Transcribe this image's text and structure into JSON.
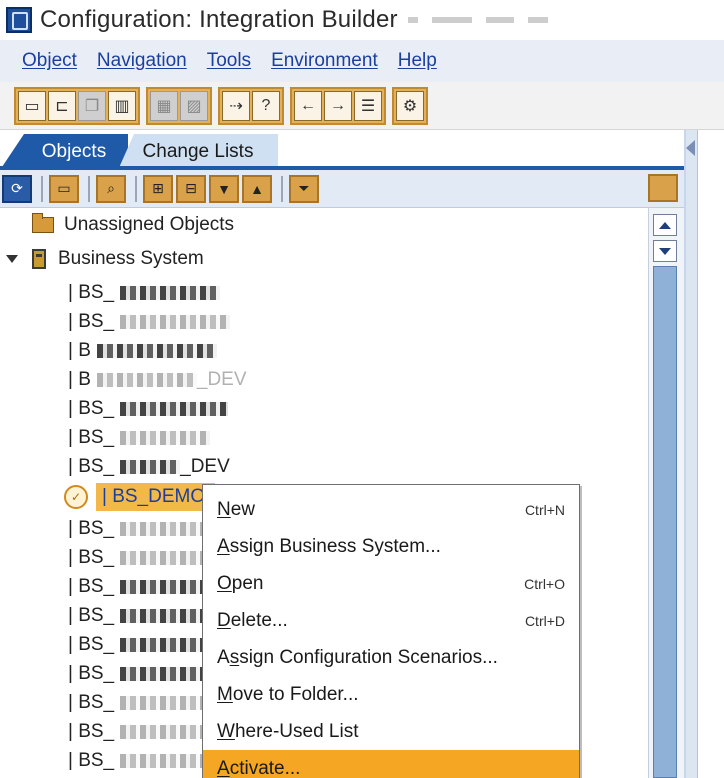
{
  "window": {
    "title": "Configuration: Integration Builder",
    "icon": "integration-builder-icon"
  },
  "menubar": {
    "items": [
      {
        "label": "Object",
        "mnemonic": "O"
      },
      {
        "label": "Navigation",
        "mnemonic": "N"
      },
      {
        "label": "Tools",
        "mnemonic": "T"
      },
      {
        "label": "Environment",
        "mnemonic": "E"
      },
      {
        "label": "Help",
        "mnemonic": "H"
      }
    ]
  },
  "toolbar": {
    "buttons": [
      {
        "name": "new-document-icon",
        "enabled": true
      },
      {
        "name": "open-folder-icon",
        "enabled": true
      },
      {
        "name": "copy-icon",
        "enabled": false
      },
      {
        "name": "delete-trash-icon",
        "enabled": true
      },
      {
        "name": "print-icon",
        "enabled": false
      },
      {
        "name": "print-preview-icon",
        "enabled": false
      },
      {
        "name": "navigate-icon",
        "enabled": true
      },
      {
        "name": "where-used-icon",
        "enabled": true
      },
      {
        "name": "back-arrow-icon",
        "enabled": true
      },
      {
        "name": "forward-arrow-icon",
        "enabled": true
      },
      {
        "name": "list-view-icon",
        "enabled": true
      },
      {
        "name": "settings-icon",
        "enabled": true
      }
    ]
  },
  "tabs": [
    {
      "label": "Objects",
      "active": true
    },
    {
      "label": "Change Lists",
      "active": false
    }
  ],
  "panel_toolbar": {
    "buttons": [
      "refresh-icon",
      "folder-view-icon",
      "find-icon",
      "expand-tree-icon",
      "collapse-tree-icon",
      "move-down-icon",
      "move-up-icon",
      "filter-icon",
      "maximize-icon"
    ]
  },
  "tree": {
    "roots": [
      {
        "label": "Unassigned Objects",
        "icon": "folder-icon",
        "expanded": false
      },
      {
        "label": "Business System",
        "icon": "business-system-icon",
        "expanded": true
      }
    ],
    "children": [
      {
        "prefix": "| BS_",
        "redacted": true
      },
      {
        "prefix": "| BS_",
        "redacted": true
      },
      {
        "prefix": "| B",
        "redacted": true
      },
      {
        "prefix": "| B",
        "redacted": true,
        "suffix": "_DEV"
      },
      {
        "prefix": "| BS_",
        "redacted": true
      },
      {
        "prefix": "| BS_",
        "redacted": true
      },
      {
        "prefix": "| BS_",
        "redacted": true,
        "suffix": "_DEV"
      },
      {
        "prefix": "| BS_DEMO",
        "redacted": false,
        "selected": true
      },
      {
        "prefix": "| BS_",
        "redacted": true
      },
      {
        "prefix": "| BS_",
        "redacted": true
      },
      {
        "prefix": "| BS_",
        "redacted": true
      },
      {
        "prefix": "| BS_",
        "redacted": true
      },
      {
        "prefix": "| BS_",
        "redacted": true
      },
      {
        "prefix": "| BS_",
        "redacted": true
      },
      {
        "prefix": "| BS_",
        "redacted": true
      },
      {
        "prefix": "| BS_",
        "redacted": true
      },
      {
        "prefix": "| BS_",
        "redacted": true
      }
    ]
  },
  "context_menu": {
    "items": [
      {
        "label": "New",
        "mnemonic": "N",
        "shortcut": "Ctrl+N",
        "highlighted": false
      },
      {
        "label": "Assign Business System...",
        "mnemonic": "A",
        "shortcut": "",
        "highlighted": false
      },
      {
        "label": "Open",
        "mnemonic": "O",
        "shortcut": "Ctrl+O",
        "highlighted": false
      },
      {
        "label": "Delete...",
        "mnemonic": "D",
        "shortcut": "Ctrl+D",
        "highlighted": false
      },
      {
        "label": "Assign Configuration Scenarios...",
        "mnemonic": "s",
        "shortcut": "",
        "highlighted": false
      },
      {
        "label": "Move to Folder...",
        "mnemonic": "M",
        "shortcut": "",
        "highlighted": false
      },
      {
        "label": "Where-Used List",
        "mnemonic": "W",
        "shortcut": "",
        "highlighted": false
      },
      {
        "label": "Activate...",
        "mnemonic": "A",
        "shortcut": "",
        "highlighted": true
      }
    ]
  },
  "colors": {
    "menu_link": "#1b3f9e",
    "tab_active": "#1f5aa8",
    "tab_inactive": "#cfe0f2",
    "selection": "#f2b84a",
    "menu_highlight": "#f5a623",
    "toolbar_gold": "#e2b15a"
  }
}
